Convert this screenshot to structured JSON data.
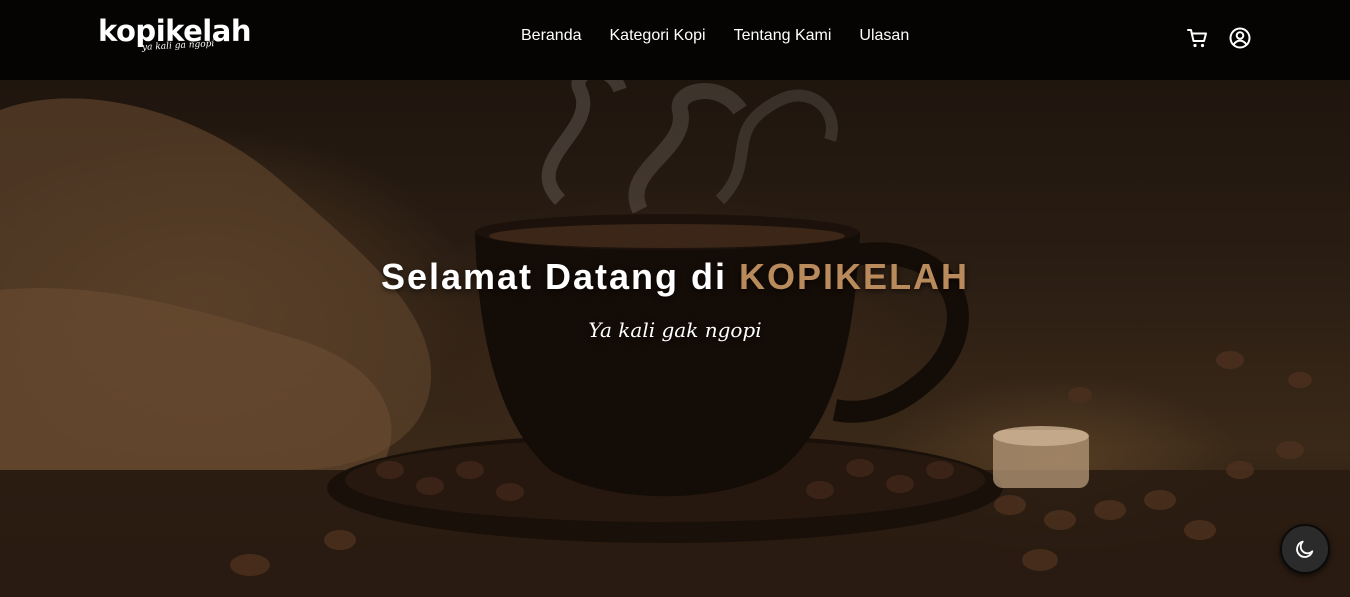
{
  "navbar": {
    "logo_text": "kopikelah",
    "logo_tagline": "ya kali ga ngopi",
    "links": [
      {
        "label": "Beranda"
      },
      {
        "label": "Kategori Kopi"
      },
      {
        "label": "Tentang Kami"
      },
      {
        "label": "Ulasan"
      }
    ],
    "icons": [
      "cart-icon",
      "user-circle-icon"
    ]
  },
  "hero": {
    "headline_prefix": "Selamat Datang di",
    "headline_brand": "KOPIKELAH",
    "tagline": "Ya kali gak ngopi",
    "brand_color": "#b98a5c"
  },
  "theme_toggle": {
    "icon": "moon-icon"
  }
}
